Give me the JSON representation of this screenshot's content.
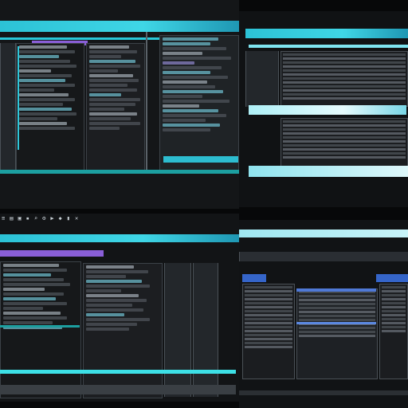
{
  "panels": {
    "top_left": {
      "toolbar_text": "",
      "statusbar_text": ""
    },
    "top_right": {
      "titlebar_text": "",
      "statusbar_text": ""
    },
    "bottom_left": {
      "toolbar_text": ""
    },
    "bottom_right": {
      "titlebar_text": ""
    }
  },
  "icons": [
    "menu-icon",
    "file-icon",
    "folder-icon",
    "save-icon",
    "search-icon",
    "gear-icon",
    "run-icon",
    "debug-icon",
    "terminal-icon",
    "close-icon"
  ],
  "colors": {
    "background": "#070809",
    "accent_cyan": "#2cc2d6",
    "accent_teal": "#1c9fa0",
    "accent_violet": "#8a5fd8",
    "accent_blue": "#3565c9",
    "panel": "#141618"
  }
}
